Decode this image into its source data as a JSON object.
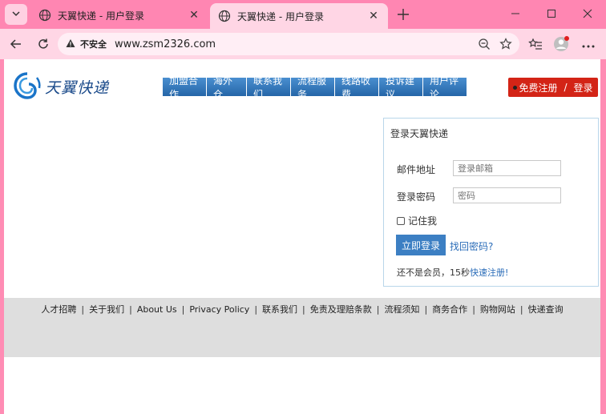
{
  "browser": {
    "tabs": [
      {
        "title": "天翼快递 - 用户登录",
        "state": "inactive"
      },
      {
        "title": "天翼快递 - 用户登录",
        "state": "active"
      }
    ],
    "address": {
      "security_label": "不安全",
      "url": "www.zsm2326.com"
    },
    "icons": {
      "tab_menu": "chevron-down-icon",
      "tab_favicon": "globe-icon",
      "tab_close": "close-icon",
      "new_tab": "plus-icon",
      "minimize": "minimize-icon",
      "maximize": "maximize-icon",
      "close_window": "close-icon",
      "back": "back-arrow-icon",
      "reload": "reload-icon",
      "warning": "warning-icon",
      "zoom": "zoom-out-icon",
      "favorite": "star-icon",
      "favorites": "favorites-icon",
      "profile": "profile-icon",
      "more": "more-icon"
    },
    "colors": {
      "tab_strip": "#ff86b2",
      "toolbar": "#ffd6e5"
    }
  },
  "site": {
    "brand": "天翼快递",
    "nav": [
      "加盟合作",
      "海外仓",
      "联系我们",
      "流程服务",
      "线路收费",
      "投诉建议",
      "用户评论"
    ],
    "register_login": {
      "register": "免费注册",
      "divider": "/",
      "login": "登录"
    },
    "colors": {
      "nav": "#2e72b6",
      "register": "#d32416",
      "primary": "#3c7fc3"
    }
  },
  "login": {
    "title": "登录天翼快递",
    "email_label": "邮件地址",
    "email_placeholder": "登录邮箱",
    "password_label": "登录密码",
    "password_placeholder": "密码",
    "remember_label": "记住我",
    "remember_checked": false,
    "submit_label": "立即登录",
    "forgot_label": "找回密码?",
    "not_member_text": "还不是会员，15秒",
    "quick_register_label": "快速注册!"
  },
  "footer": {
    "links": [
      "人才招聘",
      "关于我们",
      "About Us",
      "Privacy Policy",
      "联系我们",
      "免责及理赔条款",
      "流程须知",
      "商务合作",
      "购物网站",
      "快递查询"
    ],
    "separator": "|"
  }
}
